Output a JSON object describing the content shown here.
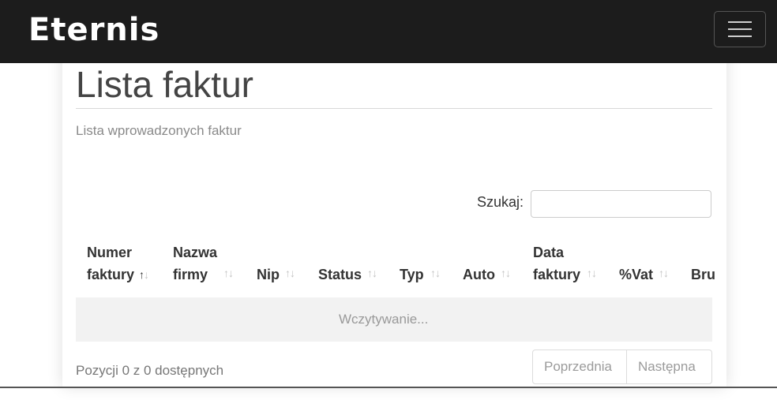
{
  "navbar": {
    "brand": "Eternis",
    "toggle_icon": "hamburger-icon"
  },
  "page": {
    "title": "Lista faktur",
    "subtitle": "Lista wprowadzonych faktur"
  },
  "search": {
    "label": "Szukaj:",
    "value": ""
  },
  "table": {
    "columns": [
      {
        "line1": "Numer",
        "line2": "faktury",
        "sort": "asc"
      },
      {
        "line1": "Nazwa",
        "line2": "firmy",
        "sort": "none"
      },
      {
        "line1": "",
        "line2": "Nip",
        "sort": "none"
      },
      {
        "line1": "",
        "line2": "Status",
        "sort": "none"
      },
      {
        "line1": "",
        "line2": "Typ",
        "sort": "none"
      },
      {
        "line1": "",
        "line2": "Auto",
        "sort": "none"
      },
      {
        "line1": "Data",
        "line2": "faktury",
        "sort": "none"
      },
      {
        "line1": "",
        "line2": "%Vat",
        "sort": "none"
      },
      {
        "line1": "",
        "line2": "Bru",
        "sort": "none"
      }
    ],
    "loading_text": "Wczytywanie..."
  },
  "footer": {
    "info": "Pozycji 0 z 0 dostępnych",
    "prev_label": "Poprzednia",
    "next_label": "Następna"
  }
}
